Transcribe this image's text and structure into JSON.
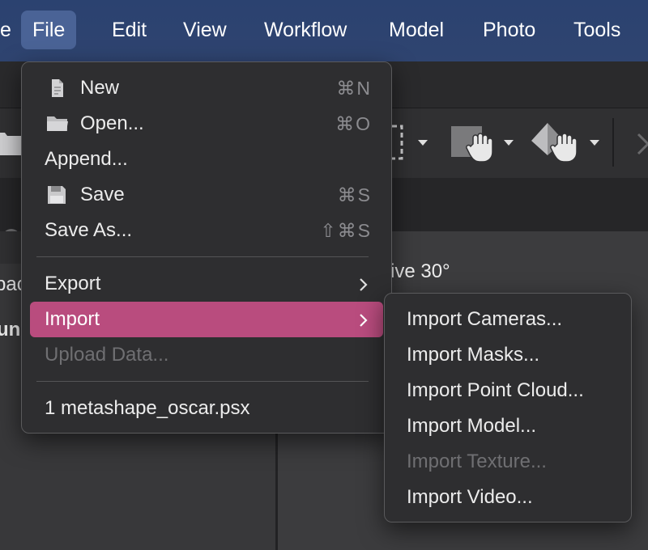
{
  "menubar": {
    "items": [
      "e",
      "File",
      "Edit",
      "View",
      "Workflow",
      "Model",
      "Photo",
      "Tools"
    ]
  },
  "background": {
    "fragment_1": "pac",
    "fragment_2": "un",
    "view_label": "ive 30°"
  },
  "file_menu": {
    "new": {
      "label": "New",
      "shortcut": "⌘N"
    },
    "open": {
      "label": "Open...",
      "shortcut": "⌘O"
    },
    "append": {
      "label": "Append..."
    },
    "save": {
      "label": "Save",
      "shortcut": "⌘S"
    },
    "save_as": {
      "label": "Save As...",
      "shortcut": "⇧⌘S"
    },
    "export": {
      "label": "Export"
    },
    "import": {
      "label": "Import"
    },
    "upload": {
      "label": "Upload Data..."
    },
    "recent_1": {
      "label": "1 metashape_oscar.psx"
    }
  },
  "import_submenu": {
    "items": [
      {
        "label": "Import Cameras...",
        "enabled": true
      },
      {
        "label": "Import Masks...",
        "enabled": true
      },
      {
        "label": "Import Point Cloud...",
        "enabled": true
      },
      {
        "label": "Import Model...",
        "enabled": true
      },
      {
        "label": "Import Texture...",
        "enabled": false
      },
      {
        "label": "Import Video...",
        "enabled": true
      }
    ]
  },
  "colors": {
    "menubar_bg": "#2f4470",
    "menubar_active": "#4a6396",
    "highlight": "#b94c7e",
    "menu_bg": "#2e2e30",
    "disabled_text": "#6f6f72"
  },
  "icons": [
    "document-icon",
    "folder-icon",
    "floppy-disk-icon",
    "chevron-right-icon",
    "pan-hand-icon",
    "checkmark-icon"
  ]
}
